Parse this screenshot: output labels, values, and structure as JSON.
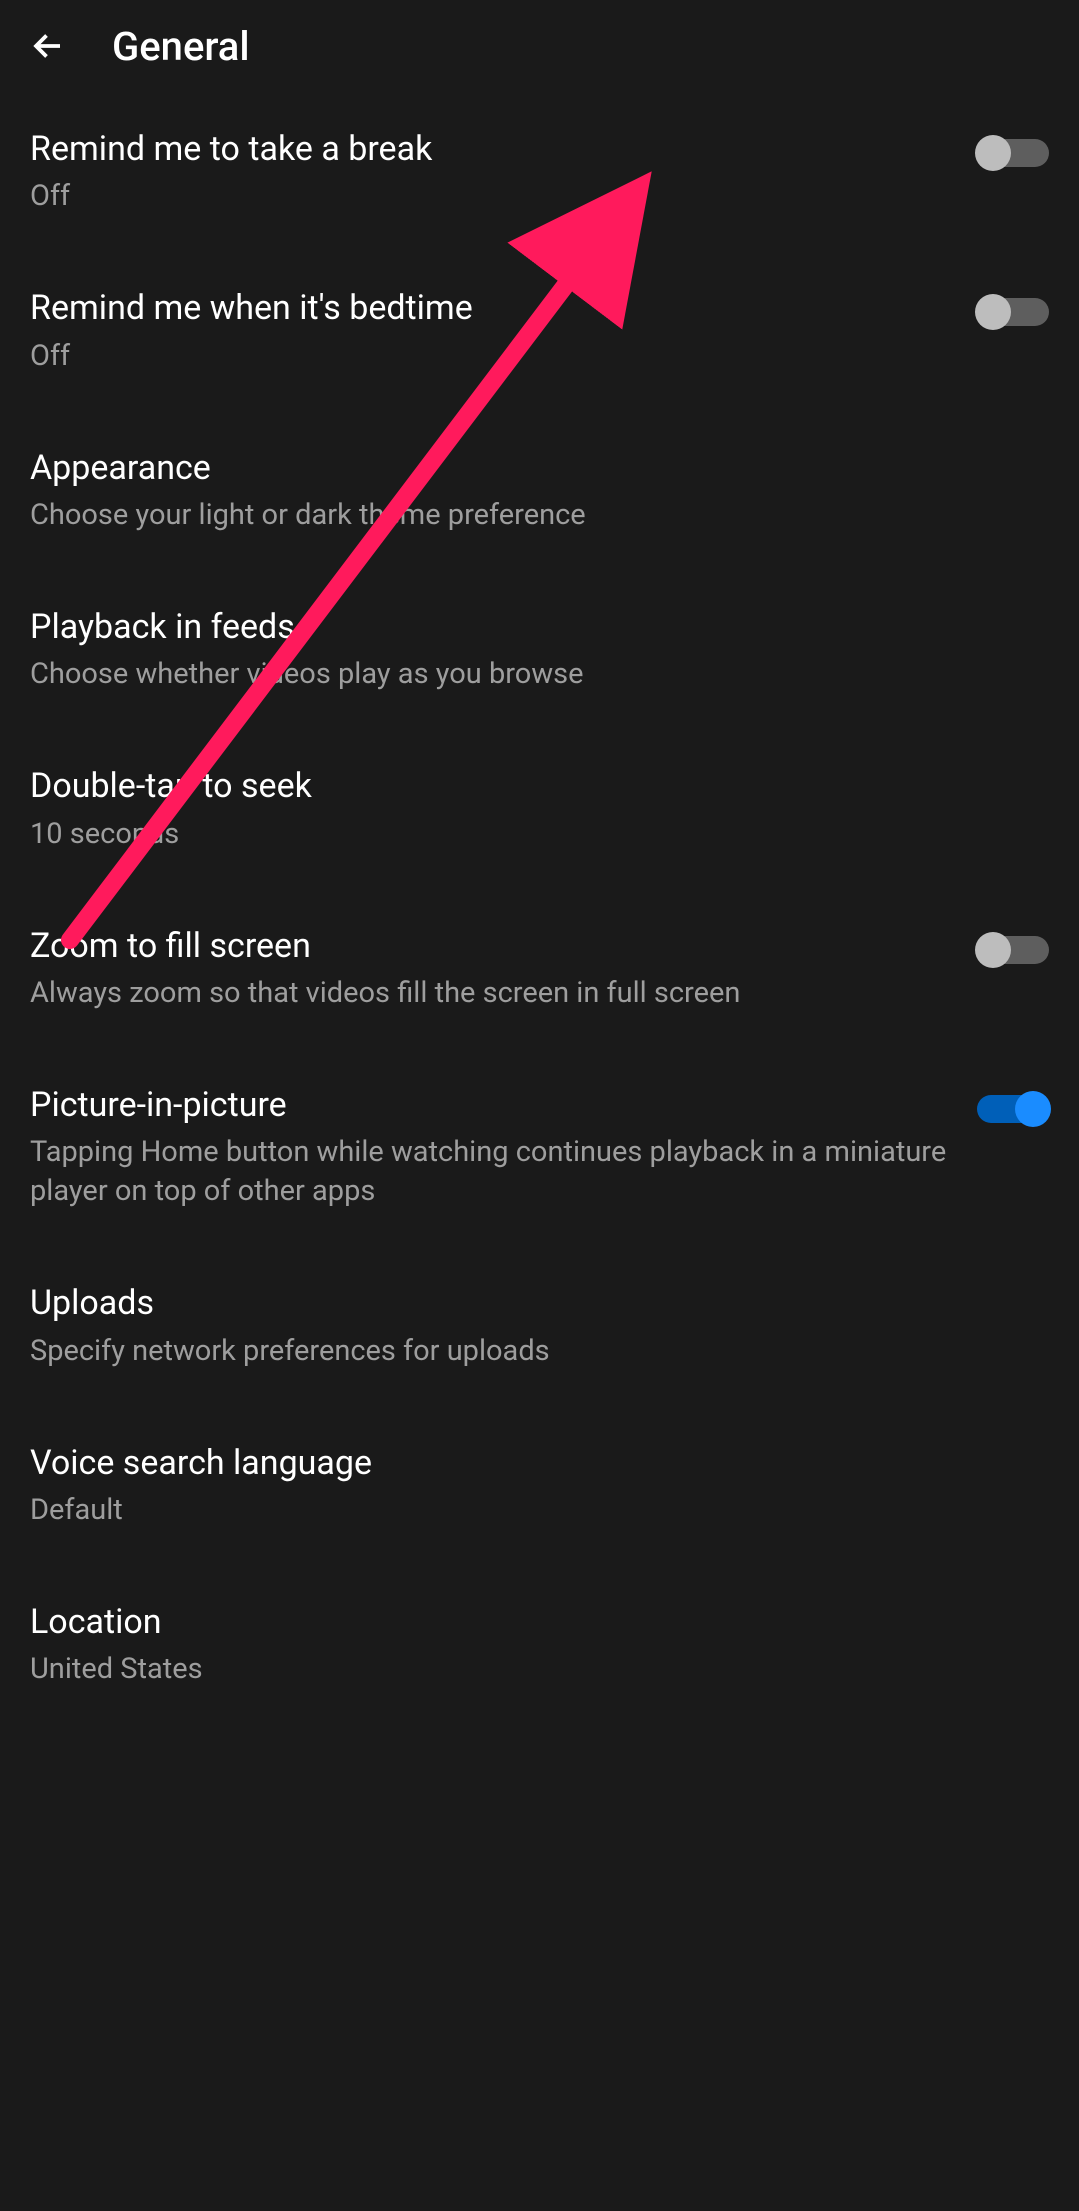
{
  "header": {
    "title": "General"
  },
  "settings": {
    "break": {
      "title": "Remind me to take a break",
      "subtitle": "Off",
      "toggle": false
    },
    "bedtime": {
      "title": "Remind me when it's bedtime",
      "subtitle": "Off",
      "toggle": false
    },
    "appearance": {
      "title": "Appearance",
      "subtitle": "Choose your light or dark theme preference"
    },
    "playback": {
      "title": "Playback in feeds",
      "subtitle": "Choose whether videos play as you browse"
    },
    "doubletap": {
      "title": "Double-tap to seek",
      "subtitle": "10 seconds"
    },
    "zoom": {
      "title": "Zoom to fill screen",
      "subtitle": "Always zoom so that videos fill the screen in full screen",
      "toggle": false
    },
    "pip": {
      "title": "Picture-in-picture",
      "subtitle": "Tapping Home button while watching continues playback in a miniature player on top of other apps",
      "toggle": true
    },
    "uploads": {
      "title": "Uploads",
      "subtitle": "Specify network preferences for uploads"
    },
    "voice": {
      "title": "Voice search language",
      "subtitle": "Default"
    },
    "location": {
      "title": "Location",
      "subtitle": "United States"
    }
  }
}
